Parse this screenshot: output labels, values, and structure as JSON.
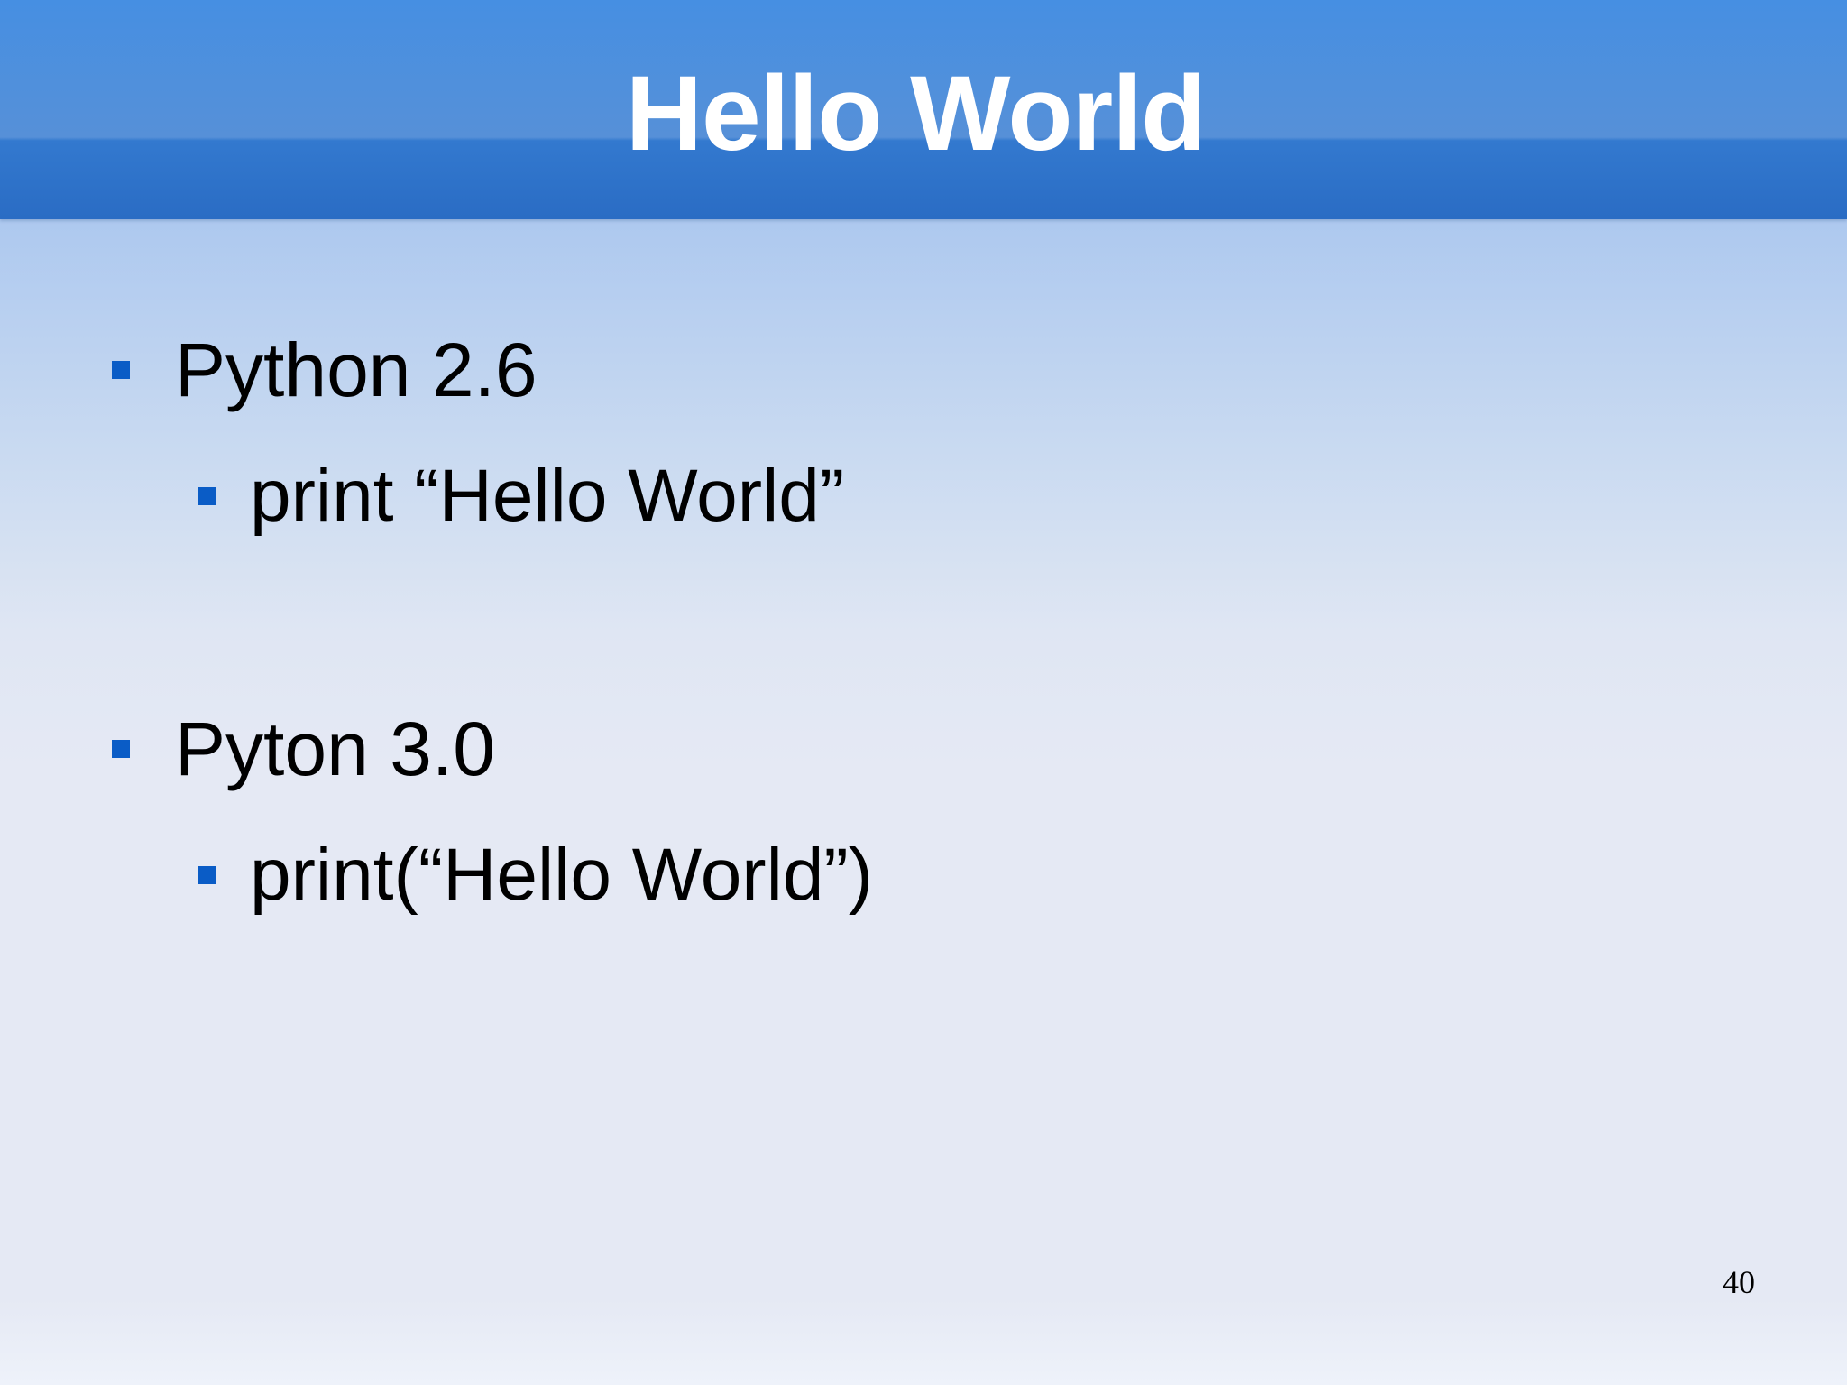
{
  "slide": {
    "title": "Hello World",
    "bullets": [
      {
        "label": "Python 2.6",
        "sub": [
          "print “Hello World”"
        ]
      },
      {
        "label": "Pyton 3.0",
        "sub": [
          "print(“Hello World”)"
        ]
      }
    ],
    "page_number": "40"
  },
  "colors": {
    "header": "#3a80d8",
    "bullet": "#0a5cc6",
    "title_text": "#ffffff",
    "body_text": "#000000"
  },
  "icons": [
    "square-bullet-icon"
  ]
}
